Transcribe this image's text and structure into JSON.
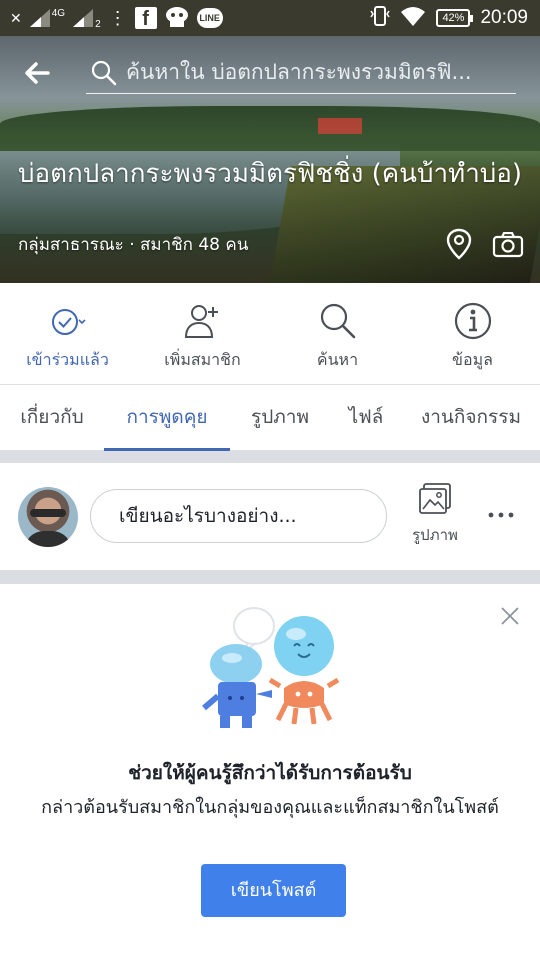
{
  "status_bar": {
    "network": "4G",
    "sim2": "2",
    "battery": "42%",
    "time": "20:09",
    "icons": [
      "close-icon",
      "signal-icon",
      "more-icon",
      "facebook-icon",
      "messenger-bot-icon",
      "line-icon",
      "vibrate-icon",
      "wifi-icon",
      "battery-icon"
    ]
  },
  "header": {
    "search_placeholder": "ค้นหาใน บ่อตกปลากระพงรวมมิตรฟิ...",
    "group_name": "บ่อตกปลากระพงรวมมิตรฟิชชิ่ง (คนบ้าทำบ่อ)",
    "group_meta": "กลุ่มสาธารณะ · สมาชิก 48 คน"
  },
  "actions": [
    {
      "label": "เข้าร่วมแล้ว",
      "icon": "joined-check-icon",
      "active": true
    },
    {
      "label": "เพิ่มสมาชิก",
      "icon": "add-member-icon",
      "active": false
    },
    {
      "label": "ค้นหา",
      "icon": "search-icon",
      "active": false
    },
    {
      "label": "ข้อมูล",
      "icon": "info-icon",
      "active": false
    }
  ],
  "tabs": [
    {
      "label": "เกี่ยวกับ"
    },
    {
      "label": "การพูดคุย",
      "active": true
    },
    {
      "label": "รูปภาพ"
    },
    {
      "label": "ไฟล์"
    },
    {
      "label": "งานกิจกรรม"
    }
  ],
  "composer": {
    "placeholder": "เขียนอะไรบางอย่าง...",
    "photo_label": "รูปภาพ"
  },
  "welcome_card": {
    "title": "ช่วยให้ผู้คนรู้สึกว่าได้รับการต้อนรับ",
    "description": "กล่าวต้อนรับสมาชิกในกลุ่มของคุณและแท็กสมาชิกในโพสต์",
    "button": "เขียนโพสต์"
  },
  "colors": {
    "accent": "#4267b2",
    "button": "#4080ea",
    "divider": "#dadde1"
  }
}
